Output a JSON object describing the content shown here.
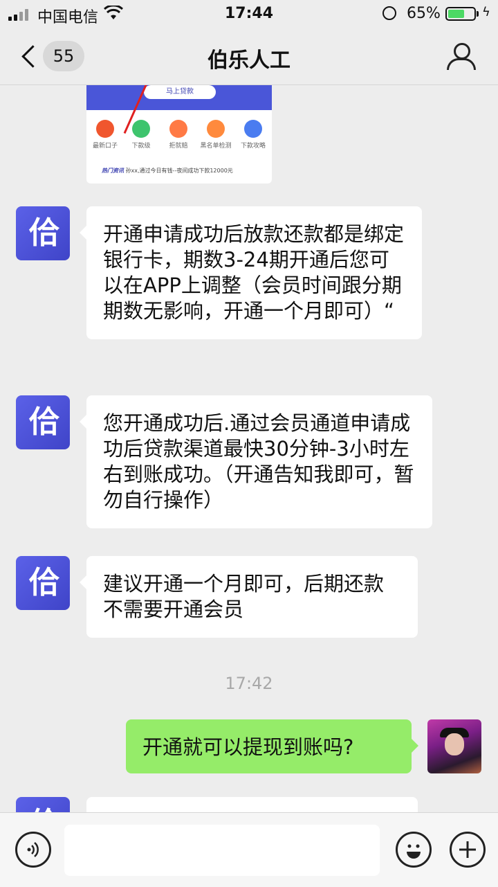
{
  "status_bar": {
    "carrier": "中国电信",
    "time": "17:44",
    "battery_percent": "65%",
    "battery_level": 0.65
  },
  "nav": {
    "unread_count": "55",
    "title": "伯乐人工"
  },
  "shared_image": {
    "button_label": "马上贷款",
    "items": [
      "最新口子",
      "下款级",
      "拒就赔",
      "黑名单检测",
      "下款攻略"
    ],
    "item_colors": [
      "#f0562e",
      "#3ec46d",
      "#ff7a45",
      "#ff8a3d",
      "#4a7cf0"
    ],
    "hot_tag": "热门资讯",
    "hot_text": "孙xx,通过今日有钱--夜间成功下款12000元"
  },
  "messages": [
    {
      "text": "开通申请成功后放款还款都是绑定银行卡，期数3-24期开通后您可以在APP上调整（会员时间跟分期期数无影响，开通一个月即可）“"
    },
    {
      "text": "您开通成功后.通过会员通道申请成功后贷款渠道最快30分钟-3小时左右到账成功。（开通告知我即可，暂勿自行操作）"
    },
    {
      "text": "建议开通一个月即可，后期还款不需要开通会员"
    }
  ],
  "timestamp": "17:42",
  "my_message": "开通就可以提现到账吗?",
  "bot_logo_glyph": "佮",
  "icons": {
    "voice": "voice-icon",
    "emoji": "emoji-icon",
    "plus": "plus-icon"
  }
}
